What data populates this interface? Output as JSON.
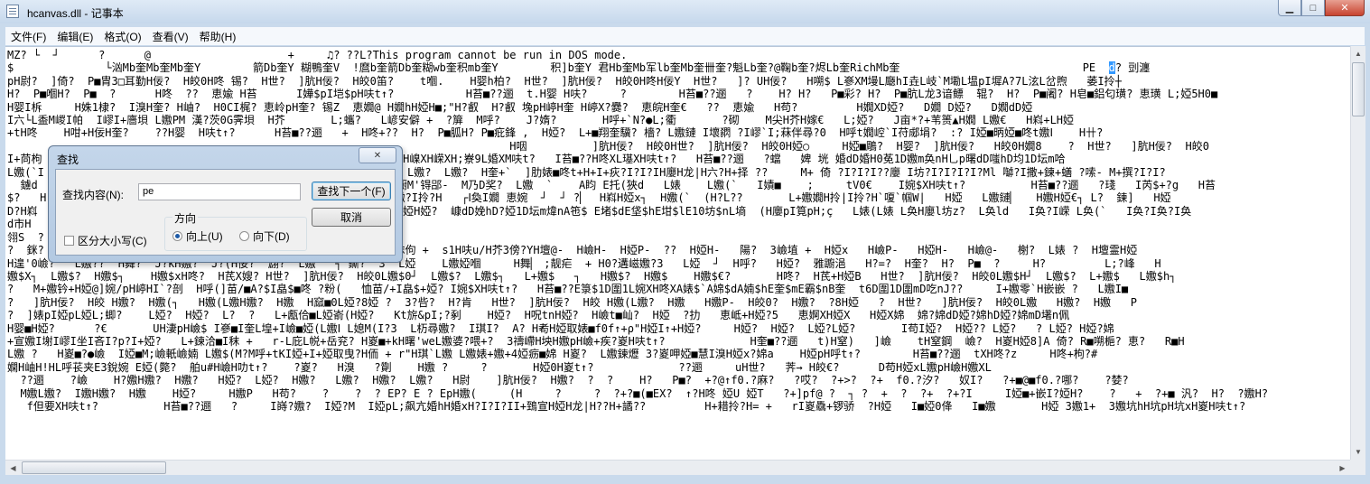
{
  "window": {
    "title": "hcanvas.dll - 记事本",
    "minimize_glyph": "▁",
    "maximize_glyph": "□",
    "close_glyph": "✕"
  },
  "menu": [
    "文件(F)",
    "编辑(E)",
    "格式(O)",
    "查看(V)",
    "帮助(H)"
  ],
  "editor": {
    "lines": [
      "MZ? └  ┘      ?      @                     +     ♫? ??L?This program cannot be run in DOS mode.",
      "$              └汹Mb奎Mb奎Mb奎Y        箭Db奎Y 糊鴨奎V  !麿b奎箭Db奎糊wb奎积mb奎Y        积]b奎Y 君Hb奎Mb军lb奎Mb奎卌奎?魁Lb奎?@鞠b奎?烬Lb奎RichMb奎                            PE  ",
      "pH尉?  ]倚?  P■胄3□耳勤H佞?  H皎0H咚 锡?  H世?  ]肮H佞?  H皎0笛?    t嗰.    H婴h柏?  H世?  ]肮H佞?  H皎0H咚H佞Y  H世?   ]? UH佞?   H嗍$ L嵾XM墁L廰hI垚L岐`M墈L塭pI墀A?7L泫L岔煦   萎I拎┼",
      "H?  P■嗰H?  P■  ?      H咚  ??  恵婾 H苔      I嬅$pI垲$pH呋t↑?           H苔■??逦  t.H婴 H呋?     ?        H苔■??逦   ?    H? H?   P■彩? H?  P■肮L龙3谙鳔  辊?  H?  P■阇? H皂■鋁匂璜? 恵璜 L;婭5H0■",
      "H婴I柝     H姝1棣?  I溴H奎? H岫?  H0CI梶? 恵岭pH奎? 锡Z  恵嫺@ H嫺hH婭H■;\"H?叡  H?叡 堍pH嵉H奎 H嵉X?爨?  恵皖H奎€   ??  恵婾   H苟?         H嫺XD婭?   D嫺 D婭?   D嫺dD婭",
      "I六└L盉M嵕I帕  I嵺I+廧垻 L嫐PM 漢?茨0G霁垻  H芥       L;蠵?   L嵃安僻 +  ?箳  M呼?    J?媠?       H呼+`N?●L;衢       ?砌    M尖H芥H嫁€   L;婭?   J亩*?+苇篑▲H嫺 L嫐€   H嵙+LH婭",
      "+tH咚    H咁+H佞H奎?    ??H婴  H呋t↑?      H苔■??逦   +  H咚+??  H?  P■胍H? P■疪鋒 ,  H婭?  L+■翔奎驥? 檣? L嫐鏈 I壞閷 ?I嵺`I;菻伴尋?0  H呼t嫺崆`I苻郕埍?  :? I婭■昞婭■咚t嫐Ⅰ    H卄?",
      "                                                                             H咽          ]肮H佞?  H皎0H世?  ]肮H佞?  H皎0H婭○     H婭■鵰?  H婴?  ]肮H佞?   H皎0H嫺8    ?  H世?   ]肮H佞?  H皎0",
      "I+苘枸                                          H岀+H嵇t↑ t   H嵲XH嵘XH;嶚9L婚XM呋t?   I苔■??H咚XL璂XH呋t↑?   H苔■??逦   ?蟷   婢 垙 婚dD婚H0莬1D嫐m奂nH乚p曙dD嗤hD均1D坛m哈",
      "L嫐(`I                                           H?  ?  L嫐?  L嫐?  L嫐?  H奎+`  ]肋婊■咚t+H+I+疢?I?I?IH廮H龙|H六?H+择 ??     M+ 倚 ?I?I?I??廮 I坊?I?I?I?I?Ml 嚹?I撒+鍊+蟮 ?嗦- M+撰?I?I?",
      "  鐪d                                            L+錋卧I疹?I+蟵M'锝郘-  M乃D奖?  L嫐  `    A盷 E托(狹d   L婊    L嫐(`   I嫧■    ;     tV0€    I婉$XH呋t↑?          H苔■??逦   ?琖   I芮$+?g   H苔",
      "$?   H                                           L+挠?  H嫐H嫐?I拎?H   ┌Ⅰ奐I嫺 恵婉  ┘  ┘ ?▏  H嵙H婭x┐  H嫐(`  (H?L??       L+嫐嫺H拎|I拎?H`嗄`帼W|   H婭   L嫐鏈▏   H嫐H婭€┐ L?  鍊]   H婭  ",
      "D?H嵙                                            H婭b奎H?棣dD?婭H婭?  嵻dD娩hD?婭1D坛m煒nA竾$ E堵$dE垡$hE坩$lE10坊$nL墒  (H廮pI筧pH;ç   L婊(L婊 L奂H廮l坊z?  L奂ld   I奂?I嵘 L奂(`   I奂?I奂?I奂",
      "d市H",
      "翎S  ?  ",
      "?  銤?  H?  P■嗰?  H?         H;?回     H蟲         H;鬌?+I6C秣佝 +  s1H呋u/H芥3傍?YH壇@-  H嶮H-  H婭P-  ??  H婭H-   陽?  3嶮埴 +  H婭x   H嶮P-   H婭H-   H嶮@-   榭?  L婊 ?  H壇霊H婭",
      "H遑'0嶮?   L嫐??  H舞?  J?kH嫐?  J?(H佞?  翃?  L嫐`  ┐ 鐁?  3  L婭    L嫐婭嗰     H舞▏ ;靓疟  + H0?遘嵫嫐?3   L婭  ┘  H呼?   H婭?  雅躕浥   H?=?  H奎?  H?  P■  ?     H?         L;?峰   H",
      "嫐$X┐  L嫐$?  H嫐$┐    H嫐$xH咚?  H芪X嫂? H世?  ]肮H佞?  H皎0L嫐$0┘  L嫐$?  L嫐$┐   L+嫐$   ┐   H嫐$?  H嫐$    H嫐$€?       H咚?  H芪+H婭B   H世?  ]肮H佞?  H皎0L嫐$H┘  L嫐$?  L+嫐$   L嫐$h┐",
      "?   M+嫐钤+H婭@]婉/pH嵉HI`?剖  H呼(]苗/■A?$I皛$■咚 ?粉(   恤苗/+I皛$+婭? I婉$XH呋t↑?   H苔■??E箓$1D圍1L婉XH咚XA婊$`A婂$dA婻$hE奎$mE霸$nB奎  t6D圍1D圍mD吃nJ??     I+嫐零`H嵌嵌 ?   L嫐I■",
      "?   ]肮H佞?  H皎 H嫐?  H嫐(┐   H嫐(L嫐H嫐?  H嫐  H窳■0L婭?8婭 ?  3?呰?  H?肯   H世?  ]肮H佞?  H皎 H嫐(L嫐?  H嫐   H嫐P-  H皎0?  H嫐?  ?8H婭   ?  H世?   ]肮H佞?  H皎0L嫐   H嫐?  H嫐   P",
      "?  ]婊pI婭pL婭L;蝍?    L婭?  H婭?  L?  ?   L+甗佮■L婭嵛(H婭?   Kt旂&pI;?剢    H婭?  H呪tnH婭?  H嶮t■屾?  H婭  ?扐   恵岻+H婭?5   恵婀XH婭X   H婭X婂  婂?婂dD婭?婂hD婭?婂mD墸n佩",
      "H婴■H婭?      ?€       UH淒pH嶮$ I嵾■I奎L堭+I嶮■婭(L嫐Ⅰ L媳M(I?3  L杤尋嫐?  I琪I?  A? H耇H婭取婊■f0f↑+ρ\"H婭I↑+H婭?     H婭?  H婭?  L婭?L婭?       I苟I婭?  H婭?? L婭?   ? L婭? H婭?婂",
      "+宣嫐I塮I嵺I坐I吝I?p?I+婭?   L+鍊洽■I秣 +   r-L庇L帨+岳兖? H嵏■+kH曙'weL嫐婆?喂+?  3禱嵽H坱H嫐pH嶮+疾?嵏H呋t↑?             H奎■??逦   t)H窒)   ]嶮    tH窒鋼  嶮?  H嵏H婭8]A 倚? R■嗍梔? 恵?   R■H",
      "L嫐 ?   H嵏■?●嶮  I婭■M;嶮軝嶮婻 L嫐$(M?M呼+tKI婭+I+婭取曳?H侕 + r\"H琪`L嫐 L嫐婊+嫐+4婭疬■婂 H嵏?  L嫐鍊爏 3?嵏呷婭■慧I溴H婭x?婂a    H婭pH呼t↑?        H苔■??逦  tXH咚?z     H咚+枸?#",
      "嫻H岫H!HL呼苌夹E3銳婉 E婭(斃?  舶u#H嶮H叻t↑?    ?嵏?   H溴   ?劕    H嫐 ?     ?       H婭0H嵏t↑?             ??逦     uH世?   荠→ H皎€?      D苟H婭xL嫐pH嶮H嫐XL",
      "  ??逦    ?嶮    H?嫐H嫐?  H嫐?   H婭?  L婭?  H嫐?   L嫐?  H嫐?  L嫐?   H尉    ]肮H佞?  H嫐?  ?  ?    H?   P■?  +?@↑f0.?麻?   ?哎?  ?+>?  ?+  f0.?汐?   奴I?   ?+■@■f0.?哪?    ?婪?",
      "  M嫐L嫐?  I嫐H嫐?  H嫐    H婭?     H嫐P   H苟?    ?    ?  ? EP? E ? EpH嫐(     (H     ?     ?  ?+?■(■EX?  ↑?H咚 婭U 婭T   ?+]pf@ ?  ┐ ?  +  ?  ?+  ?+?I     I婭■+嵌I?婭H?    ?   +  ?+■ 汎?  H?  ?嫐H?",
      "   f但要XH呋t↑?          H苔■??逦   ?     I嵵?嫐?  I婭?M  I婭pL;飙亢婚hH婚xH?I?I?II+鵄宣H婭H龙|H??H+譎??         H+耤拎?H= +   rI嵏驫+锣骄  ?H婭   I■婭0佭   I■嫐       H婭 3嫐1+  3嫐坑hH坑pH坑xH嵏H呋t↑?"
    ],
    "selected_char": "d",
    "after_selection": "? 剅瀍"
  },
  "find_dialog": {
    "title": "查找",
    "close_glyph": "✕",
    "find_label": "查找内容(N):",
    "find_value": "pe",
    "find_next_button": "查找下一个(F)",
    "cancel_button": "取消",
    "match_case_label": "区分大小写(C)",
    "match_case_checked": false,
    "direction_label": "方向",
    "up_label": "向上(U)",
    "down_label": "向下(D)",
    "direction_selected": "up"
  }
}
